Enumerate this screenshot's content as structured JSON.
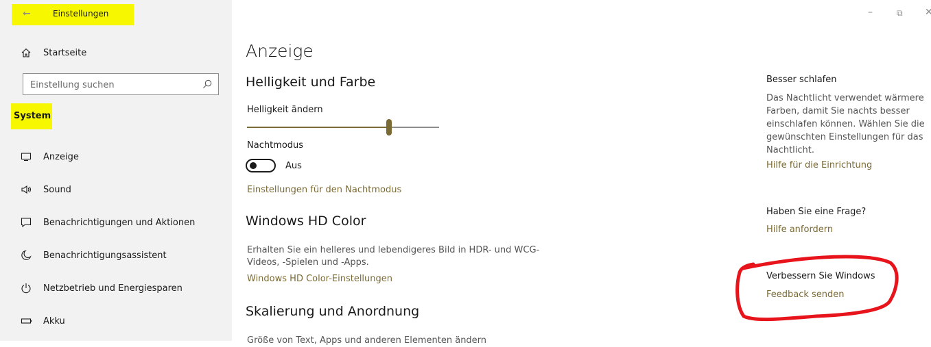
{
  "window": {
    "title": "Einstellungen",
    "minimize": "–",
    "restore": "⧉",
    "close": "✕"
  },
  "sidebar": {
    "home_label": "Startseite",
    "search_placeholder": "Einstellung suchen",
    "section_label": "System",
    "items": [
      {
        "label": "Anzeige",
        "icon": "monitor-icon"
      },
      {
        "label": "Sound",
        "icon": "speaker-icon"
      },
      {
        "label": "Benachrichtigungen und Aktionen",
        "icon": "notification-icon"
      },
      {
        "label": "Benachrichtigungsassistent",
        "icon": "moon-icon"
      },
      {
        "label": "Netzbetrieb und Energiesparen",
        "icon": "power-icon"
      },
      {
        "label": "Akku",
        "icon": "battery-icon"
      }
    ]
  },
  "main": {
    "page_title": "Anzeige",
    "brightness_section": {
      "heading": "Helligkeit und Farbe",
      "brightness_label": "Helligkeit ändern",
      "brightness_level": 0.74,
      "nightmode_label": "Nachtmodus",
      "nightmode_state": "Aus",
      "nightmode_link": "Einstellungen für den Nachtmodus"
    },
    "hdr_section": {
      "heading": "Windows HD Color",
      "description_line1": "Erhalten Sie ein helleres und lebendigeres Bild in HDR- und WCG-",
      "description_line2": "Videos, -Spielen und -Apps.",
      "link": "Windows HD Color-Einstellungen"
    },
    "scaling_section": {
      "heading": "Skalierung und Anordnung",
      "cut_text": "Größe von Text, Apps und anderen Elementen ändern"
    }
  },
  "right": {
    "sleep": {
      "heading": "Besser schlafen",
      "lines": [
        "Das Nachtlicht verwendet wärmere",
        "Farben, damit Sie nachts besser",
        "einschlafen können. Wählen Sie die",
        "gewünschten Einstellungen für das",
        "Nachtlicht."
      ],
      "link": "Hilfe für die Einrichtung"
    },
    "question": {
      "heading": "Haben Sie eine Frage?",
      "link": "Hilfe anfordern"
    },
    "improve": {
      "heading": "Verbessern Sie Windows",
      "link": "Feedback senden"
    }
  },
  "colors": {
    "accent": "#7a6a34",
    "highlight": "#f7f700",
    "annotation": "#e8141c",
    "sidebar_bg": "#f2f2f2"
  }
}
